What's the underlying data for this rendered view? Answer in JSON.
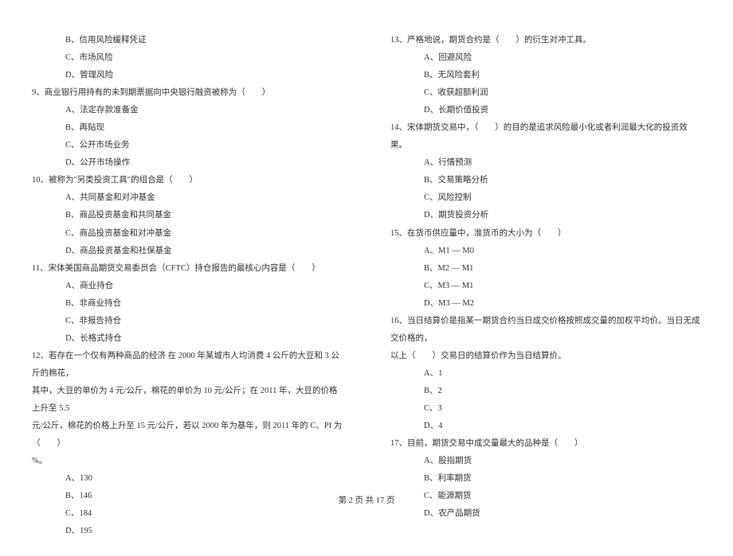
{
  "left": {
    "q8": {
      "b": "B、信用风险缓释凭证",
      "c": "C、市场风险",
      "d": "D、管理风险"
    },
    "q9": {
      "stem": "9、商业银行用持有的未到期票据向中央银行融资被称为（　　）",
      "a": "A、法定存款准备金",
      "b": "B、再贴现",
      "c": "C、公开市场业务",
      "d": "D、公开市场操作"
    },
    "q10": {
      "stem": "10、被称为\"另类投资工具\"的组合是（　　）",
      "a": "A、共同基金和对冲基金",
      "b": "B、商品投资基金和共同基金",
      "c": "C、商品投资基金和对冲基金",
      "d": "D、商品投资基金和社保基金"
    },
    "q11": {
      "stem": "11、宋体美国商品期货交易委员会（CFTC）持仓报告的最核心内容是（　　）",
      "a": "A、商业持仓",
      "b": "B、非商业持仓",
      "c": "C、非报告持仓",
      "d": "D、长格式持仓"
    },
    "q12": {
      "stem1": "12、若存在一个仅有两种商品的经济 在 2000 年某城市人均消费 4 公斤的大豆和 3 公斤的棉花，",
      "stem2": "其中，大豆的单价为 4 元/公斤，棉花的单价为 10 元/公斤；在 2011 年，大豆的价格上升至 5.5",
      "stem3": "元/公斤，棉花的价格上升至 15 元/公斤，若以 2000 年为基年，则 2011 年的 C、PI 为（　　）",
      "stem4": "%。",
      "a": "A、130",
      "b": "B、146",
      "c": "C、184",
      "d": "D、195"
    }
  },
  "right": {
    "q13": {
      "stem": "13、严格地说，期货合约是（　　）的衍生对冲工具。",
      "a": "A、回避风险",
      "b": "B、无风险套利",
      "c": "C、收获超额利润",
      "d": "D、长期价值投资"
    },
    "q14": {
      "stem": "14、宋体期货交易中，（　　）的目的是追求风险最小化或者利润最大化的投资效果。",
      "a": "A、行情预测",
      "b": "B、交易策略分析",
      "c": "C、风险控制",
      "d": "D、期货投资分析"
    },
    "q15": {
      "stem": "15、在货币供应量中，准货币的大小为（　　）",
      "a": "A、M1 — M0",
      "b": "B、M2 — M1",
      "c": "C、M3 — M1",
      "d": "D、M3 — M2"
    },
    "q16": {
      "stem1": "16、当日结算价是指某一期货合约当日成交价格按照成交量的加权平均价。当日无成交价格的，",
      "stem2": "以上（　　）交易日的结算价作为当日结算价。",
      "a": "A、1",
      "b": "B、2",
      "c": "C、3",
      "d": "D、4"
    },
    "q17": {
      "stem": "17、目前，期货交易中成交量最大的品种是（　　）",
      "a": "A、股指期货",
      "b": "B、利率期货",
      "c": "C、能源期货",
      "d": "D、农产品期货"
    }
  },
  "footer": "第 2 页 共 17 页"
}
